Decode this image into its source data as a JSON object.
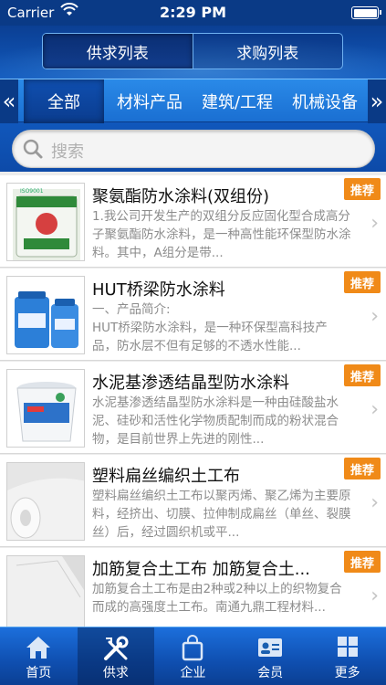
{
  "status_bar": {
    "carrier": "Carrier",
    "time": "2:29 PM"
  },
  "segment": {
    "tabs": [
      {
        "label": "供求列表",
        "active": true
      },
      {
        "label": "求购列表",
        "active": false
      }
    ]
  },
  "categories": {
    "items": [
      {
        "label": "全部",
        "active": true
      },
      {
        "label": "材料产品",
        "active": false
      },
      {
        "label": "建筑/工程",
        "active": false
      },
      {
        "label": "机械设备",
        "active": false
      }
    ],
    "left_arrow": "«",
    "right_arrow": "»"
  },
  "search": {
    "placeholder": "搜索"
  },
  "products": [
    {
      "title": "聚氨酯防水涂料(双组份)",
      "desc": "1.我公司开发生产的双组分反应固化型合成高分子聚氨酯防水涂料，是一种高性能环保型防水涂料。其中，A组分是带...",
      "badge": "推荐",
      "image": "paint-bucket-green"
    },
    {
      "title": " HUT桥梁防水涂料",
      "desc": "一、产品简介:\nHUT桥梁防水涂料，是一种环保型高科技产品，防水层不但有足够的不透水性能...",
      "badge": "推荐",
      "image": "blue-barrels"
    },
    {
      "title": "水泥基渗透结晶型防水涂料",
      "desc": "水泥基渗透结晶型防水涂料是一种由硅酸盐水泥、硅砂和活性化学物质配制而成的粉状混合物，是目前世界上先进的刚性...",
      "badge": "推荐",
      "image": "white-bucket"
    },
    {
      "title": "塑料扁丝编织土工布",
      "desc": "塑料扁丝编织土工布以聚丙烯、聚乙烯为主要原料，经挤出、切膜、拉伸制成扁丝（单丝、裂膜丝）后，经过圆织机或平...",
      "badge": "推荐",
      "image": "fabric-roll"
    },
    {
      "title": " 加筋复合土工布 加筋复合土...",
      "desc": "加筋复合土工布是由2种或2种以上的织物复合而成的高强度土工布。南通九鼎工程材料...",
      "badge": "推荐",
      "image": "fabric-sheet"
    }
  ],
  "tabbar": {
    "items": [
      {
        "label": "首页",
        "icon": "home-icon",
        "active": false
      },
      {
        "label": "供求",
        "icon": "tools-icon",
        "active": true
      },
      {
        "label": "企业",
        "icon": "bag-icon",
        "active": false
      },
      {
        "label": "会员",
        "icon": "member-card-icon",
        "active": false
      },
      {
        "label": "更多",
        "icon": "grid-icon",
        "active": false
      }
    ]
  },
  "colors": {
    "header_blue": "#0b3f93",
    "accent_blue": "#1a6fd2",
    "badge_orange": "#f08a18"
  }
}
